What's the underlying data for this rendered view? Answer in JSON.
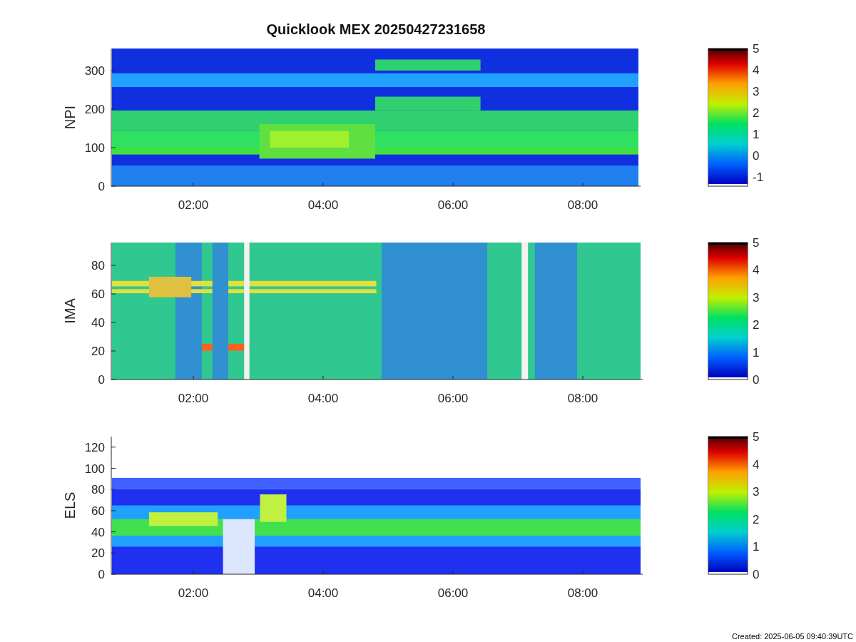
{
  "title": "Quicklook MEX 20250427231658",
  "panels": [
    {
      "ylabel": "NPI",
      "yticks": [
        "300",
        "200",
        "100",
        "0"
      ],
      "xticks": [
        "02:00",
        "04:00",
        "06:00",
        "08:00"
      ],
      "colorbar_ticks": [
        "5",
        "4",
        "3",
        "2",
        "1",
        "0",
        "-1"
      ]
    },
    {
      "ylabel": "IMA",
      "yticks": [
        "80",
        "60",
        "40",
        "20",
        "0"
      ],
      "xticks": [
        "02:00",
        "04:00",
        "06:00",
        "08:00"
      ],
      "colorbar_ticks": [
        "5",
        "4",
        "3",
        "2",
        "1",
        "0"
      ]
    },
    {
      "ylabel": "ELS",
      "yticks": [
        "120",
        "100",
        "80",
        "60",
        "40",
        "20",
        "0"
      ],
      "xticks": [
        "02:00",
        "04:00",
        "06:00",
        "08:00"
      ],
      "colorbar_ticks": [
        "5",
        "4",
        "3",
        "2",
        "1",
        "0"
      ]
    }
  ],
  "footer": "Created: 2025-06-05 09:40:39UTC"
}
